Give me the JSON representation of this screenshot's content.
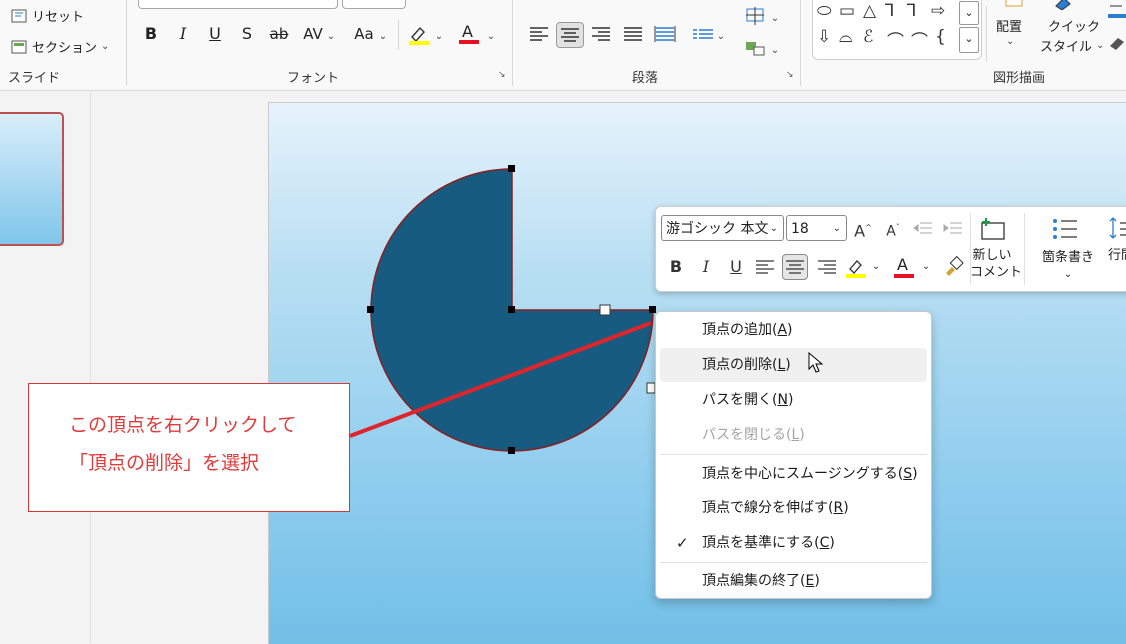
{
  "ribbon": {
    "slide_group": {
      "reset_label": "リセット",
      "section_label": "セクション",
      "group_label": "スライド"
    },
    "font_group": {
      "group_label": "フォント",
      "bold": "B",
      "italic": "I",
      "underline": "U",
      "shadow": "S",
      "strike": "ab",
      "spacing": "AV",
      "case": "Aa",
      "highlight_color": "#ffff00",
      "font_color": "#e81123"
    },
    "paragraph_group": {
      "group_label": "段落"
    },
    "drawing_group": {
      "arrange_label": "配置",
      "quick_style_line1": "クイック",
      "quick_style_line2": "スタイル",
      "group_label": "図形描画"
    }
  },
  "mini_toolbar": {
    "font_name": "游ゴシック 本文",
    "font_size": "18",
    "new_comment_line1": "新しい",
    "new_comment_line2": "コメント",
    "bullets_label": "箇条書き",
    "line_spacing_label": "行間"
  },
  "callout": {
    "line1": "この頂点を右クリックして",
    "line2": "「頂点の削除」を選択",
    "color": "#e03b3b"
  },
  "context_menu": {
    "items": [
      {
        "pre": "頂点の追加(",
        "key": "A",
        "post": ")"
      },
      {
        "pre": "頂点の削除(",
        "key": "L",
        "post": ")"
      },
      {
        "pre": "パスを開く(",
        "key": "N",
        "post": ")"
      },
      {
        "pre": "パスを閉じる(",
        "key": "L",
        "post": ")"
      },
      {
        "pre": "頂点を中心にスムージングする(",
        "key": "S",
        "post": ")"
      },
      {
        "pre": "頂点で線分を伸ばす(",
        "key": "R",
        "post": ")"
      },
      {
        "pre": "頂点を基準にする(",
        "key": "C",
        "post": ")"
      },
      {
        "pre": "頂点編集の終了(",
        "key": "E",
        "post": ")"
      }
    ],
    "checkmark": "✓"
  },
  "colors": {
    "shape_fill": "#175c80",
    "shape_outline": "#8b1f1f",
    "pointer_line": "#e0242c"
  }
}
